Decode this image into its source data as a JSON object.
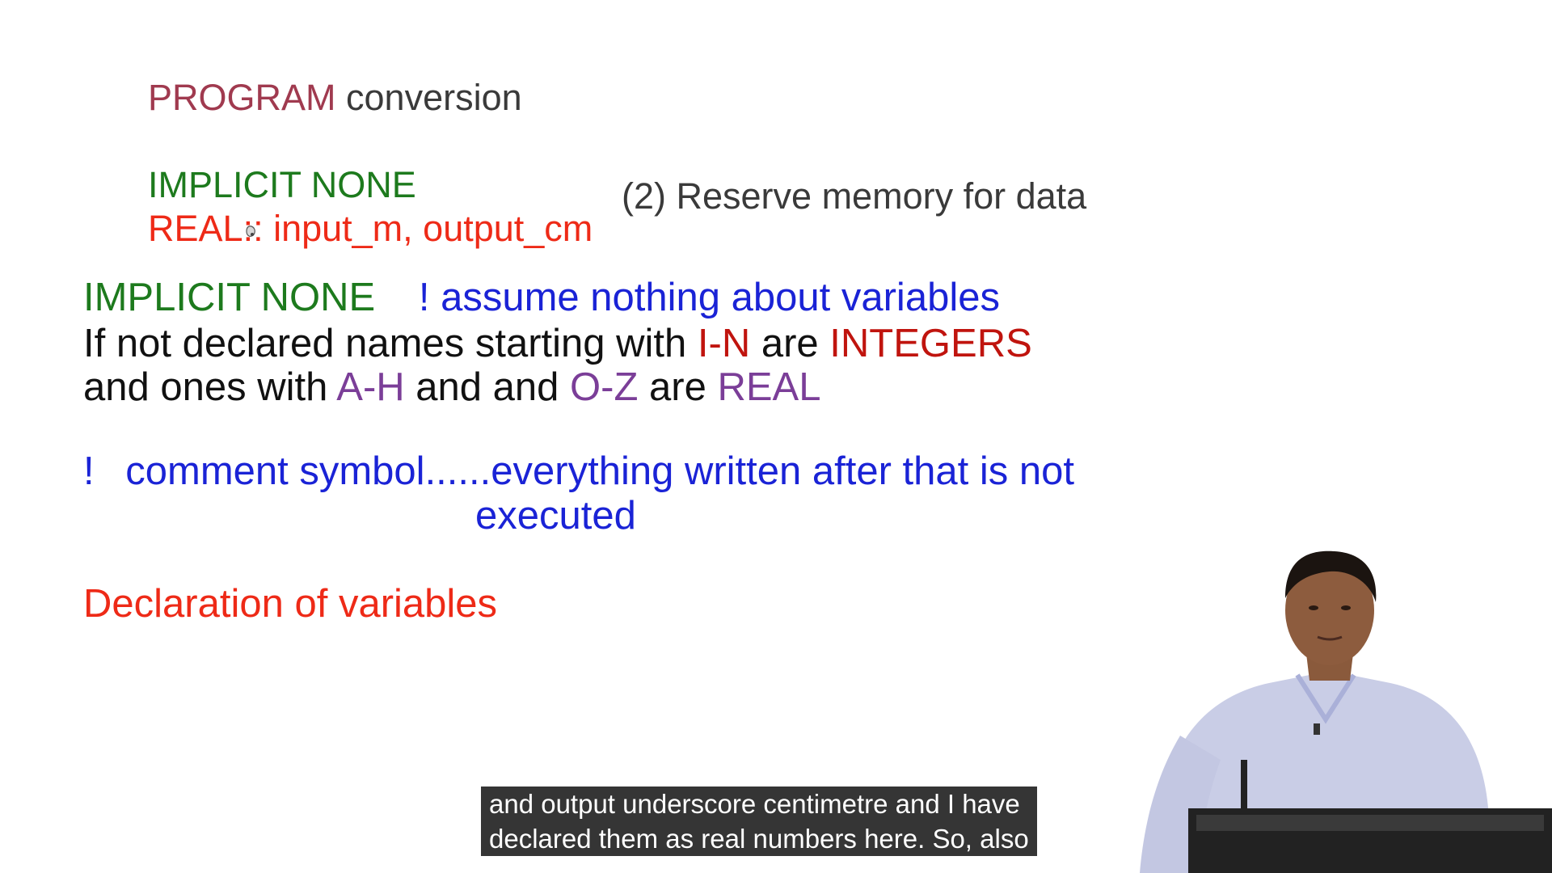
{
  "slide": {
    "program_line": {
      "keyword": "PROGRAM",
      "name": "conversion"
    },
    "implicit_line_1": "IMPLICIT NONE",
    "real_line": {
      "keyword": "REAL",
      "rest": ":: input_m, output_cm"
    },
    "reserve_note": "(2) Reserve memory for data",
    "implicit_line_2": {
      "keyword": "IMPLICIT NONE",
      "comment": "! assume nothing about variables"
    },
    "rule_line_1": {
      "before": "If not declared names starting with ",
      "range": "I-N",
      "middle": " are ",
      "type": "INTEGERS"
    },
    "rule_line_2": {
      "before": "and ones with ",
      "range1": "A-H",
      "middle1": " and and ",
      "range2": "O-Z",
      "middle2": " are ",
      "type": "REAL"
    },
    "comment_line": {
      "bang": "!",
      "text1": "comment symbol......everything written after that is not",
      "text2": "executed"
    },
    "declaration_heading": "Declaration of variables"
  },
  "subtitle": {
    "line1": "and output underscore centimetre and I have",
    "line2": "declared them as real numbers here. So, also"
  },
  "colors": {
    "program": "#a03a4f",
    "green": "#1d7a1d",
    "red": "#ee2a17",
    "dark_red": "#c0140e",
    "blue": "#1a23d6",
    "purple": "#7b3e98"
  }
}
